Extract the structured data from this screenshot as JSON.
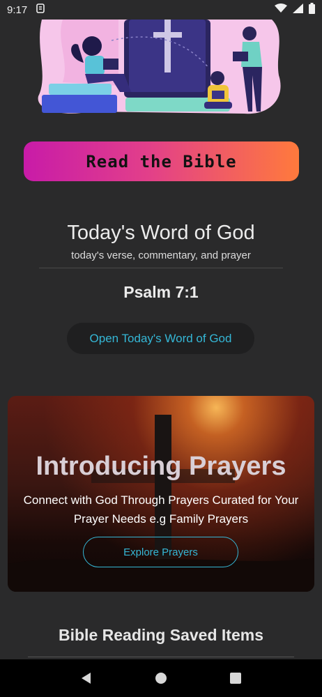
{
  "status_bar": {
    "time": "9:17",
    "icons": [
      "notification-icon",
      "wifi-icon",
      "signal-icon",
      "battery-icon"
    ]
  },
  "hero": {
    "image": "bible-reading-illustration"
  },
  "read_bible_button": {
    "label": "Read the Bible"
  },
  "word_of_god": {
    "title": "Today's Word of God",
    "subtitle": "today's verse, commentary, and prayer",
    "verse_reference": "Psalm 7:1",
    "open_button_label": "Open Today's Word of God"
  },
  "prayer_card": {
    "title": "Introducing Prayers",
    "description": "Connect with God Through Prayers Curated for Your Prayer Needs e.g Family Prayers",
    "button_label": "Explore Prayers"
  },
  "saved_section": {
    "title": "Bible Reading Saved Items"
  },
  "nav_bar": {
    "icons": [
      "back-icon",
      "home-icon",
      "recents-icon"
    ]
  },
  "colors": {
    "background": "#2a2a2b",
    "accent_link": "#35b7d6",
    "button_gradient_start": "#c81ba8",
    "button_gradient_end": "#ff7a3c"
  }
}
